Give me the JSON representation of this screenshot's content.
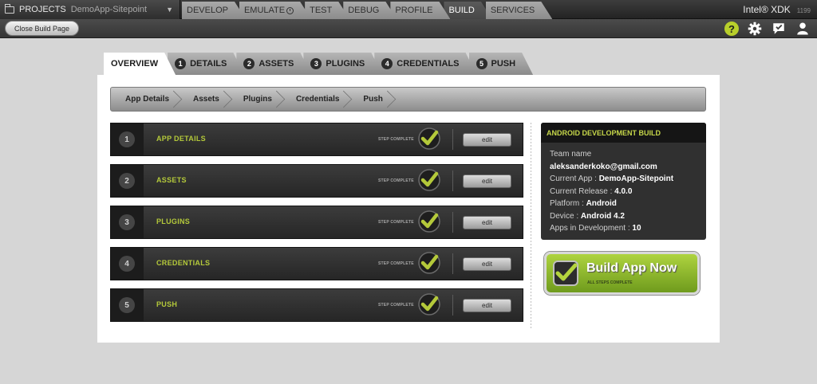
{
  "topbar": {
    "projects_label": "PROJECTS",
    "project_name": "DemoApp-Sitepoint",
    "tabs": [
      {
        "label": "DEVELOP",
        "active": false
      },
      {
        "label": "EMULATE",
        "active": false,
        "icon": "clock-icon"
      },
      {
        "label": "TEST",
        "active": false
      },
      {
        "label": "DEBUG",
        "active": false
      },
      {
        "label": "PROFILE",
        "active": false
      },
      {
        "label": "BUILD",
        "active": true
      },
      {
        "label": "SERVICES",
        "active": false
      }
    ],
    "brand": "Intel® XDK",
    "version": "1199"
  },
  "toolbar": {
    "close_label": "Close Build Page",
    "icons": [
      "help-icon",
      "gear-icon",
      "feedback-icon",
      "user-icon"
    ],
    "help_glyph": "?"
  },
  "build_tabs": [
    {
      "num": "",
      "label": "OVERVIEW",
      "active": true
    },
    {
      "num": "1",
      "label": "DETAILS",
      "active": false
    },
    {
      "num": "2",
      "label": "ASSETS",
      "active": false
    },
    {
      "num": "3",
      "label": "PLUGINS",
      "active": false
    },
    {
      "num": "4",
      "label": "CREDENTIALS",
      "active": false
    },
    {
      "num": "5",
      "label": "PUSH",
      "active": false
    }
  ],
  "breadcrumb": [
    "App Details",
    "Assets",
    "Plugins",
    "Credentials",
    "Push"
  ],
  "steps": [
    {
      "num": "1",
      "name": "APP DETAILS",
      "status": "STEP COMPLETE",
      "edit": "edit"
    },
    {
      "num": "2",
      "name": "ASSETS",
      "status": "STEP COMPLETE",
      "edit": "edit"
    },
    {
      "num": "3",
      "name": "PLUGINS",
      "status": "STEP COMPLETE",
      "edit": "edit"
    },
    {
      "num": "4",
      "name": "CREDENTIALS",
      "status": "STEP COMPLETE",
      "edit": "edit"
    },
    {
      "num": "5",
      "name": "PUSH",
      "status": "STEP COMPLETE",
      "edit": "edit"
    }
  ],
  "info": {
    "title": "ANDROID DEVELOPMENT BUILD",
    "team_label": "Team name",
    "team_value": "aleksanderkoko@gmail.com",
    "app_label": "Current App : ",
    "app_value": "DemoApp-Sitepoint",
    "release_label": "Current Release : ",
    "release_value": "4.0.0",
    "platform_label": "Platform : ",
    "platform_value": "Android",
    "device_label": "Device : ",
    "device_value": "Android 4.2",
    "apps_label": "Apps in Development : ",
    "apps_value": "10"
  },
  "build_button": {
    "label": "Build App Now",
    "sub": "ALL STEPS COMPLETE"
  },
  "colors": {
    "accent_green": "#b4c93a",
    "build_green": "#8cb82c",
    "dark_panel": "#303030"
  }
}
